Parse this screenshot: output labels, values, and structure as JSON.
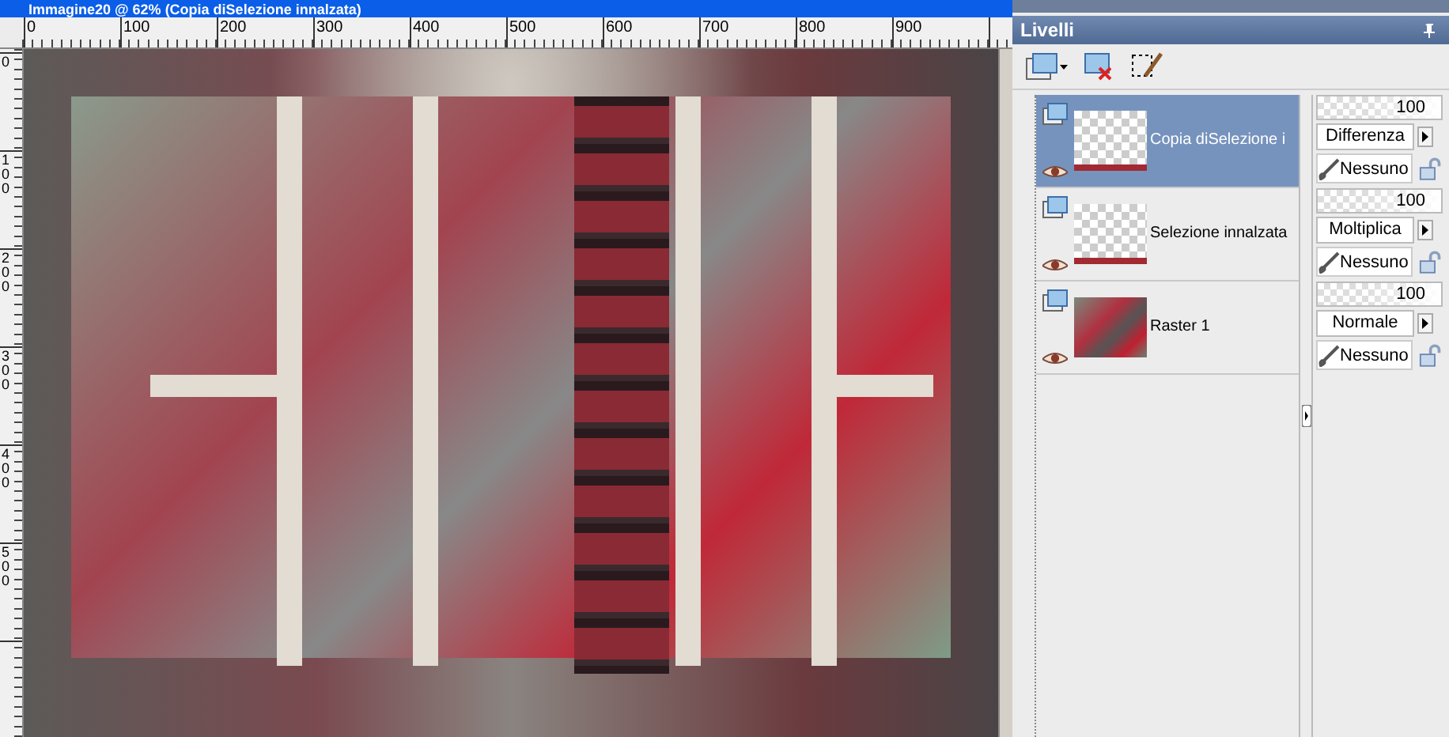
{
  "window": {
    "title": "Immagine20 @ 62% (Copia diSelezione innalzata)"
  },
  "rulers": {
    "horizontal": [
      "0",
      "100",
      "200",
      "300",
      "400",
      "500",
      "600",
      "700",
      "800",
      "900"
    ],
    "vertical": [
      "0",
      "100",
      "200",
      "300",
      "400",
      "500"
    ]
  },
  "layers_panel": {
    "title": "Livelli",
    "layers": [
      {
        "name": "Copia diSelezione i",
        "kind": "transparent",
        "selected": true,
        "visible": true,
        "opacity": "100",
        "level": 1,
        "blend_mode": "Differenza",
        "mask": "Nessuno"
      },
      {
        "name": "Selezione innalzata",
        "kind": "transparent",
        "selected": false,
        "visible": true,
        "opacity": "100",
        "level": 1,
        "blend_mode": "Moltiplica",
        "mask": "Nessuno"
      },
      {
        "name": "Raster 1",
        "kind": "image",
        "selected": false,
        "visible": true,
        "opacity": "100",
        "level": 1,
        "blend_mode": "Normale",
        "mask": "Nessuno"
      }
    ]
  }
}
